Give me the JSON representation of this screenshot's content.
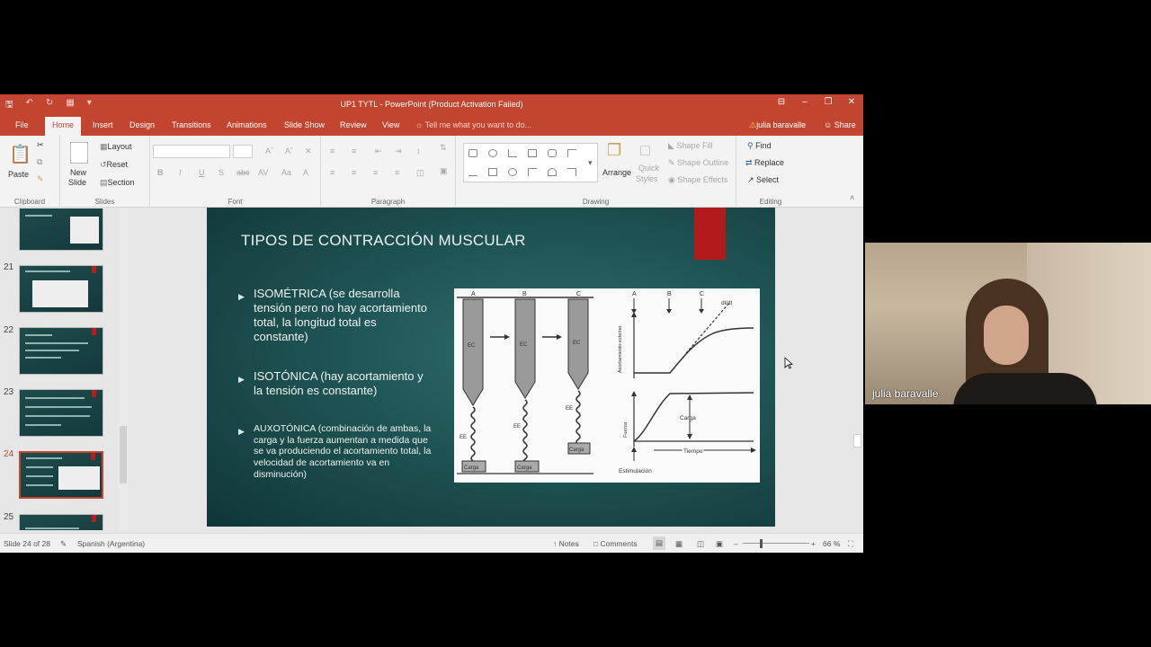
{
  "window": {
    "title": "UP1 TYTL - PowerPoint (Product Activation Failed)",
    "quick_access": [
      "save",
      "undo",
      "redo",
      "present",
      "customize"
    ]
  },
  "tabs": [
    "File",
    "Home",
    "Insert",
    "Design",
    "Transitions",
    "Animations",
    "Slide Show",
    "Review",
    "View"
  ],
  "active_tab": "Home",
  "tell_me": "Tell me what you want to do...",
  "user_name": "julia baravalle",
  "share_label": "Share",
  "ribbon": {
    "clipboard": {
      "paste": "Paste",
      "label": "Clipboard"
    },
    "slides": {
      "new_slide": "New",
      "new_slide2": "Slide",
      "layout": "Layout",
      "reset": "Reset",
      "section": "Section",
      "label": "Slides"
    },
    "font": {
      "label": "Font"
    },
    "paragraph": {
      "label": "Paragraph"
    },
    "drawing": {
      "arrange": "Arrange",
      "quick_styles_1": "Quick",
      "quick_styles_2": "Styles",
      "shape_fill": "Shape Fill",
      "shape_outline": "Shape Outline",
      "shape_effects": "Shape Effects",
      "label": "Drawing"
    },
    "editing": {
      "find": "Find",
      "replace": "Replace",
      "select": "Select",
      "label": "Editing"
    }
  },
  "thumbnails": [
    {
      "num": "",
      "active": false
    },
    {
      "num": "21",
      "active": false
    },
    {
      "num": "22",
      "active": false
    },
    {
      "num": "23",
      "active": false
    },
    {
      "num": "24",
      "active": true
    },
    {
      "num": "25",
      "active": false
    }
  ],
  "slide": {
    "title": "TIPOS DE CONTRACCIÓN MUSCULAR",
    "bullets": [
      "ISOMÉTRICA (se desarrolla tensión pero no hay acortamiento total, la longitud total es constante)",
      "ISOTÓNICA (hay acortamiento y la tensión es constante)",
      "AUXOTÓNICA (combinación de ambas, la carga y la fuerza aumentan a medida que se va produciendo el acortamiento total, la velocidad de acortamiento va en disminución)"
    ],
    "figure": {
      "letters": [
        "A",
        "B",
        "C"
      ],
      "ec": "EC",
      "ee": "EE",
      "carga": "Carga",
      "ddt": "dl/dt",
      "y_top": "Acortamiento externo",
      "y_bottom": "Fuerza",
      "carga_label": "Carga",
      "tiempo": "Tiempo",
      "estimulacion": "Estimulación"
    }
  },
  "status": {
    "slide_info": "Slide 24 of 28",
    "language": "Spanish (Argentina)",
    "notes": "Notes",
    "comments": "Comments",
    "zoom": "66 %"
  },
  "webcam": {
    "name": "julia baravalle"
  },
  "colors": {
    "accent": "#c2452f",
    "slide_bg": "#1f5454",
    "slide_red": "#b11b1b"
  }
}
